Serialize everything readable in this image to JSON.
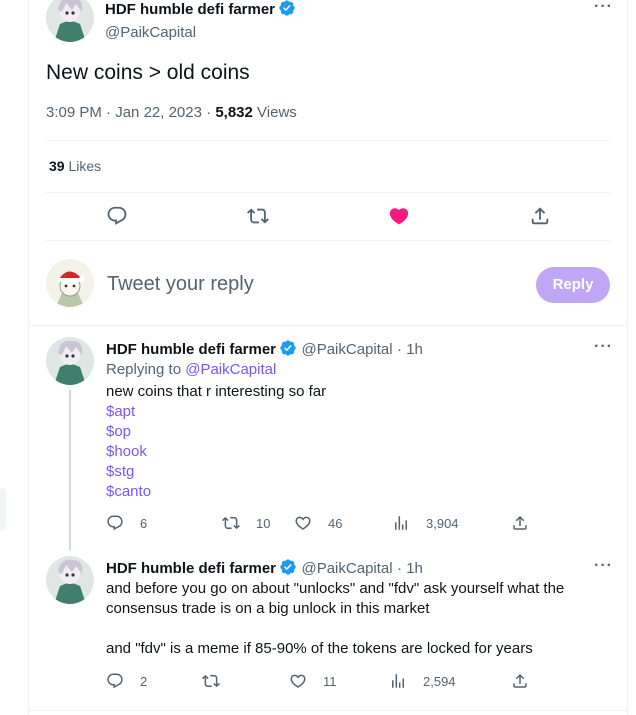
{
  "main_tweet": {
    "author_name": "HDF humble defi farmer",
    "handle": "@PaikCapital",
    "text": "New coins > old coins",
    "time": "3:09 PM",
    "date": "Jan 22, 2023",
    "views_count": "5,832",
    "views_label": "Views",
    "likes_count": "39",
    "likes_label": "Likes",
    "liked": true
  },
  "reply_box": {
    "placeholder": "Tweet your reply",
    "button_label": "Reply",
    "button_color": "#c0a6f5"
  },
  "replies": [
    {
      "author_name": "HDF humble defi farmer",
      "handle": "@PaikCapital",
      "time": "1h",
      "replying_to_label": "Replying to",
      "replying_to_handle": "@PaikCapital",
      "lines": [
        "new coins that r interesting so far"
      ],
      "cashtags": [
        "$apt",
        "$op",
        "$hook",
        "$stg",
        "$canto"
      ],
      "stats": {
        "replies": "6",
        "retweets": "10",
        "likes": "46",
        "views": "3,904"
      }
    },
    {
      "author_name": "HDF humble defi farmer",
      "handle": "@PaikCapital",
      "time": "1h",
      "lines": [
        "and before you go on about \"unlocks\" and \"fdv\" ask yourself what the",
        "consensus trade is on a big unlock in this market",
        "",
        "and \"fdv\" is a meme if 85-90% of the tokens are locked for years"
      ],
      "stats": {
        "replies": "2",
        "retweets": "",
        "likes": "11",
        "views": "2,594"
      }
    }
  ],
  "colors": {
    "accent": "#7856ff",
    "like": "#f91880",
    "verified": "#1d9bf0"
  }
}
